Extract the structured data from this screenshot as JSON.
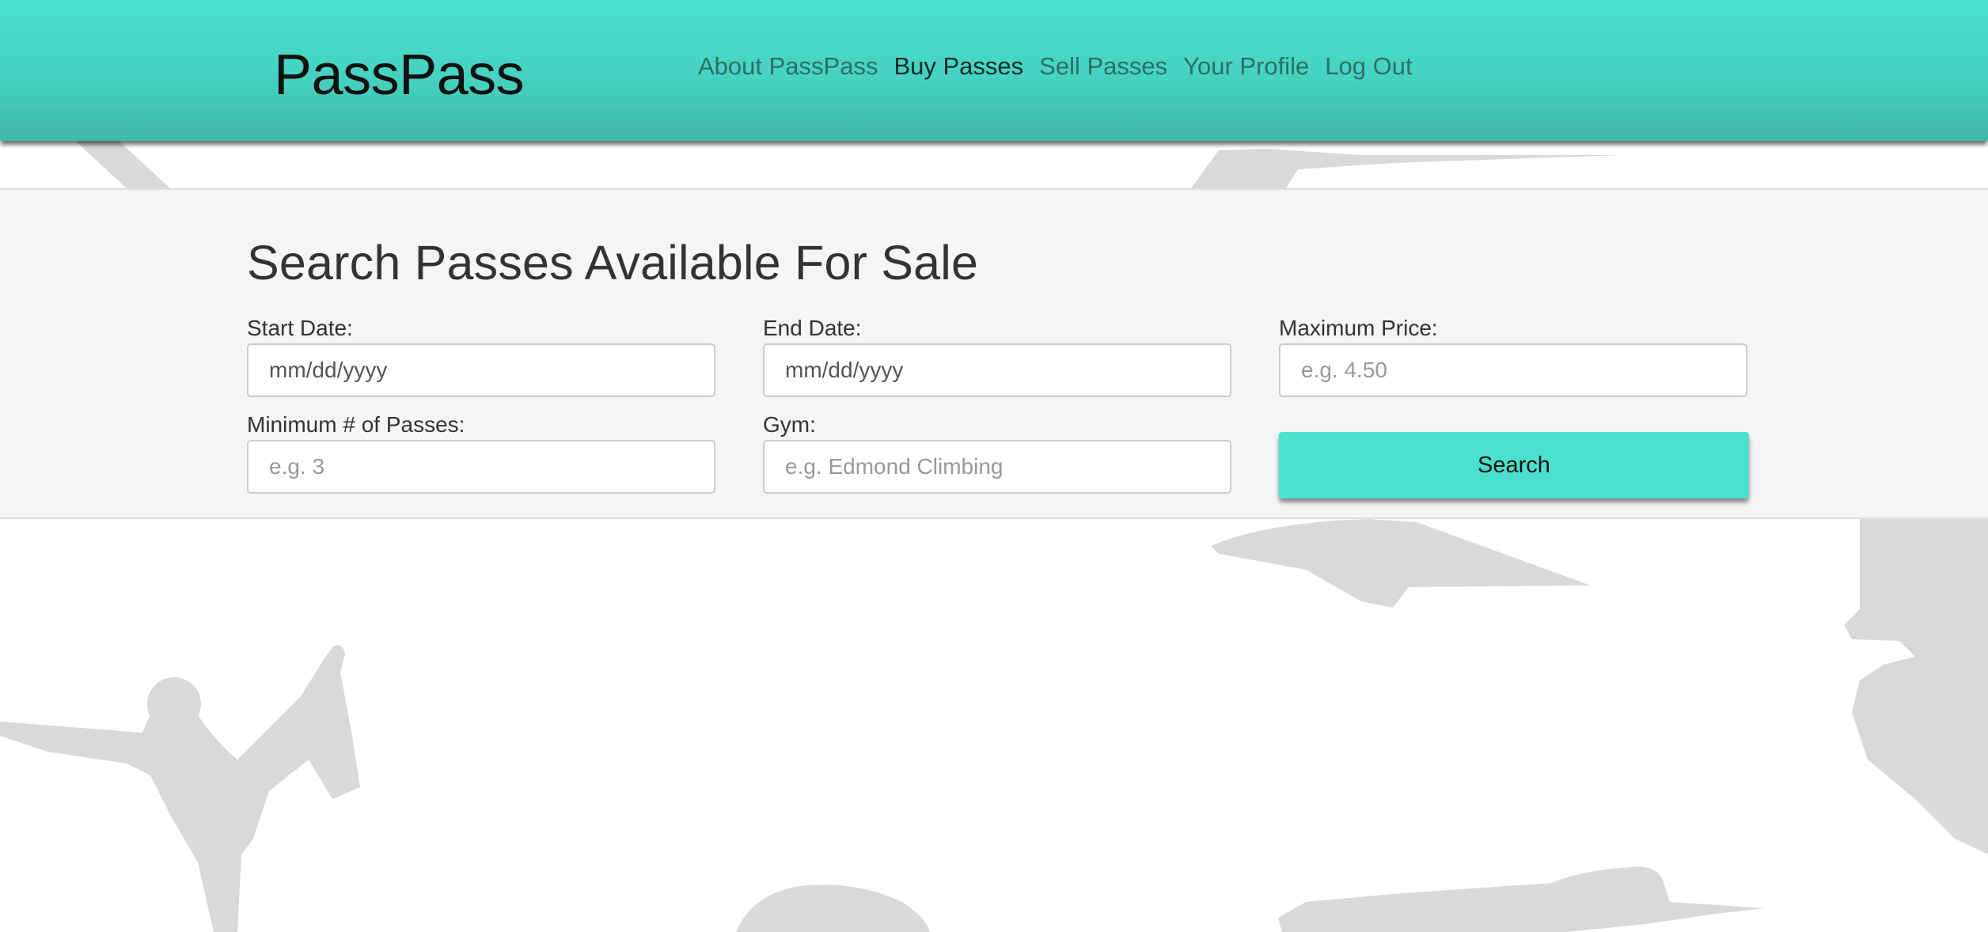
{
  "header": {
    "brand": "PassPass",
    "nav": [
      {
        "label": "About PassPass",
        "active": false
      },
      {
        "label": "Buy Passes",
        "active": true
      },
      {
        "label": "Sell Passes",
        "active": false
      },
      {
        "label": "Your Profile",
        "active": false
      },
      {
        "label": "Log Out",
        "active": false
      }
    ]
  },
  "search": {
    "title": "Search Passes Available For Sale",
    "start_date": {
      "label": "Start Date:",
      "placeholder": "mm/dd/yyyy",
      "value": ""
    },
    "end_date": {
      "label": "End Date:",
      "placeholder": "mm/dd/yyyy",
      "value": ""
    },
    "max_price": {
      "label": "Maximum Price:",
      "placeholder": "e.g. 4.50",
      "value": ""
    },
    "min_passes": {
      "label": "Minimum # of Passes:",
      "placeholder": "e.g. 3",
      "value": ""
    },
    "gym": {
      "label": "Gym:",
      "placeholder": "e.g. Edmond Climbing",
      "value": ""
    },
    "button_label": "Search"
  },
  "colors": {
    "accent": "#4ae0cc",
    "header_dark": "#3fb8aa",
    "panel_bg": "#f5f5f5",
    "silhouette": "#d9d9d9"
  },
  "icons": {
    "background": "yoga-silhouettes-icon"
  }
}
